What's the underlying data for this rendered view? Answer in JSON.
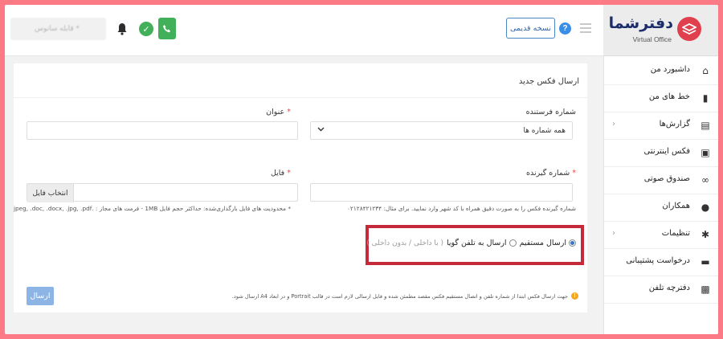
{
  "brand": {
    "title": "دفترشما",
    "subtitle": "Virtual Office",
    "logo_icon": "logo-mark"
  },
  "header": {
    "search_placeholder": "قابله سانوس *",
    "old_version_label": "نسخه قدیمی",
    "help_glyph": "?",
    "icons": [
      "bell-icon",
      "verified-icon",
      "phone-icon",
      "help-icon",
      "menu-icon"
    ]
  },
  "sidebar": {
    "items": [
      {
        "label": "داشبورد من",
        "icon": "home-icon",
        "glyph": "⌂",
        "has_children": false
      },
      {
        "label": "خط های من",
        "icon": "sim-icon",
        "glyph": "▮",
        "has_children": false
      },
      {
        "label": "گزارش‌ها",
        "icon": "report-icon",
        "glyph": "▤",
        "has_children": true
      },
      {
        "label": "فکس اینترنتی",
        "icon": "fax-icon",
        "glyph": "▣",
        "has_children": false
      },
      {
        "label": "صندوق صوتی",
        "icon": "voicemail-icon",
        "glyph": "∞",
        "has_children": false
      },
      {
        "label": "همکاران",
        "icon": "users-icon",
        "glyph": "●",
        "has_children": false
      },
      {
        "label": "تنظیمات",
        "icon": "gear-icon",
        "glyph": "✱",
        "has_children": true
      },
      {
        "label": "درخواست پشتیبانی",
        "icon": "ticket-icon",
        "glyph": "▬",
        "has_children": false
      },
      {
        "label": "دفترچه تلفن",
        "icon": "contacts-icon",
        "glyph": "▩",
        "has_children": false
      }
    ],
    "chevron": "‹"
  },
  "form": {
    "title": "ارسال فکس جدید",
    "sender_label": "شماره فرستنده",
    "sender_value": "همه شماره ها",
    "subject_label": "عنوان",
    "required_mark": "*",
    "receiver_label": "شماره گیرنده",
    "receiver_hint": "شماره گیرنده فکس را به صورت دقیق همراه با کد شهر وارد نمایید. برای مثال: ۰۲۱۲۸۴۲۱۲۳۴",
    "file_label": "فایل",
    "file_button": "انتخاب فایل",
    "file_hint": "* محدودیت های فایل بارگذاری‌شده: حداکثر حجم فایل 1MB - فرمت های مجاز : .jpeg, .doc, .docx, .jpg, .pdf",
    "radio_options": [
      {
        "label": "ارسال مستقیم",
        "selected": true,
        "sub": ""
      },
      {
        "label": "ارسال به تلفن گویا",
        "selected": false,
        "sub": "( با داخلی / بدون داخلی )"
      }
    ],
    "info_text": "جهت ارسال فکس ابتدا از شماره تلفن و اتصال مستقیم فکس مقصد مطمئن شده و فایل ارسالی لازم است در قالب Portrait و در ابعاد A4 ارسال شود.",
    "send_button": "ارسال"
  },
  "colors": {
    "accent": "#3a75c4",
    "highlight_border": "#c62a3a",
    "phone_green": "#42b05a",
    "frame_pink": "#fb7a86"
  }
}
